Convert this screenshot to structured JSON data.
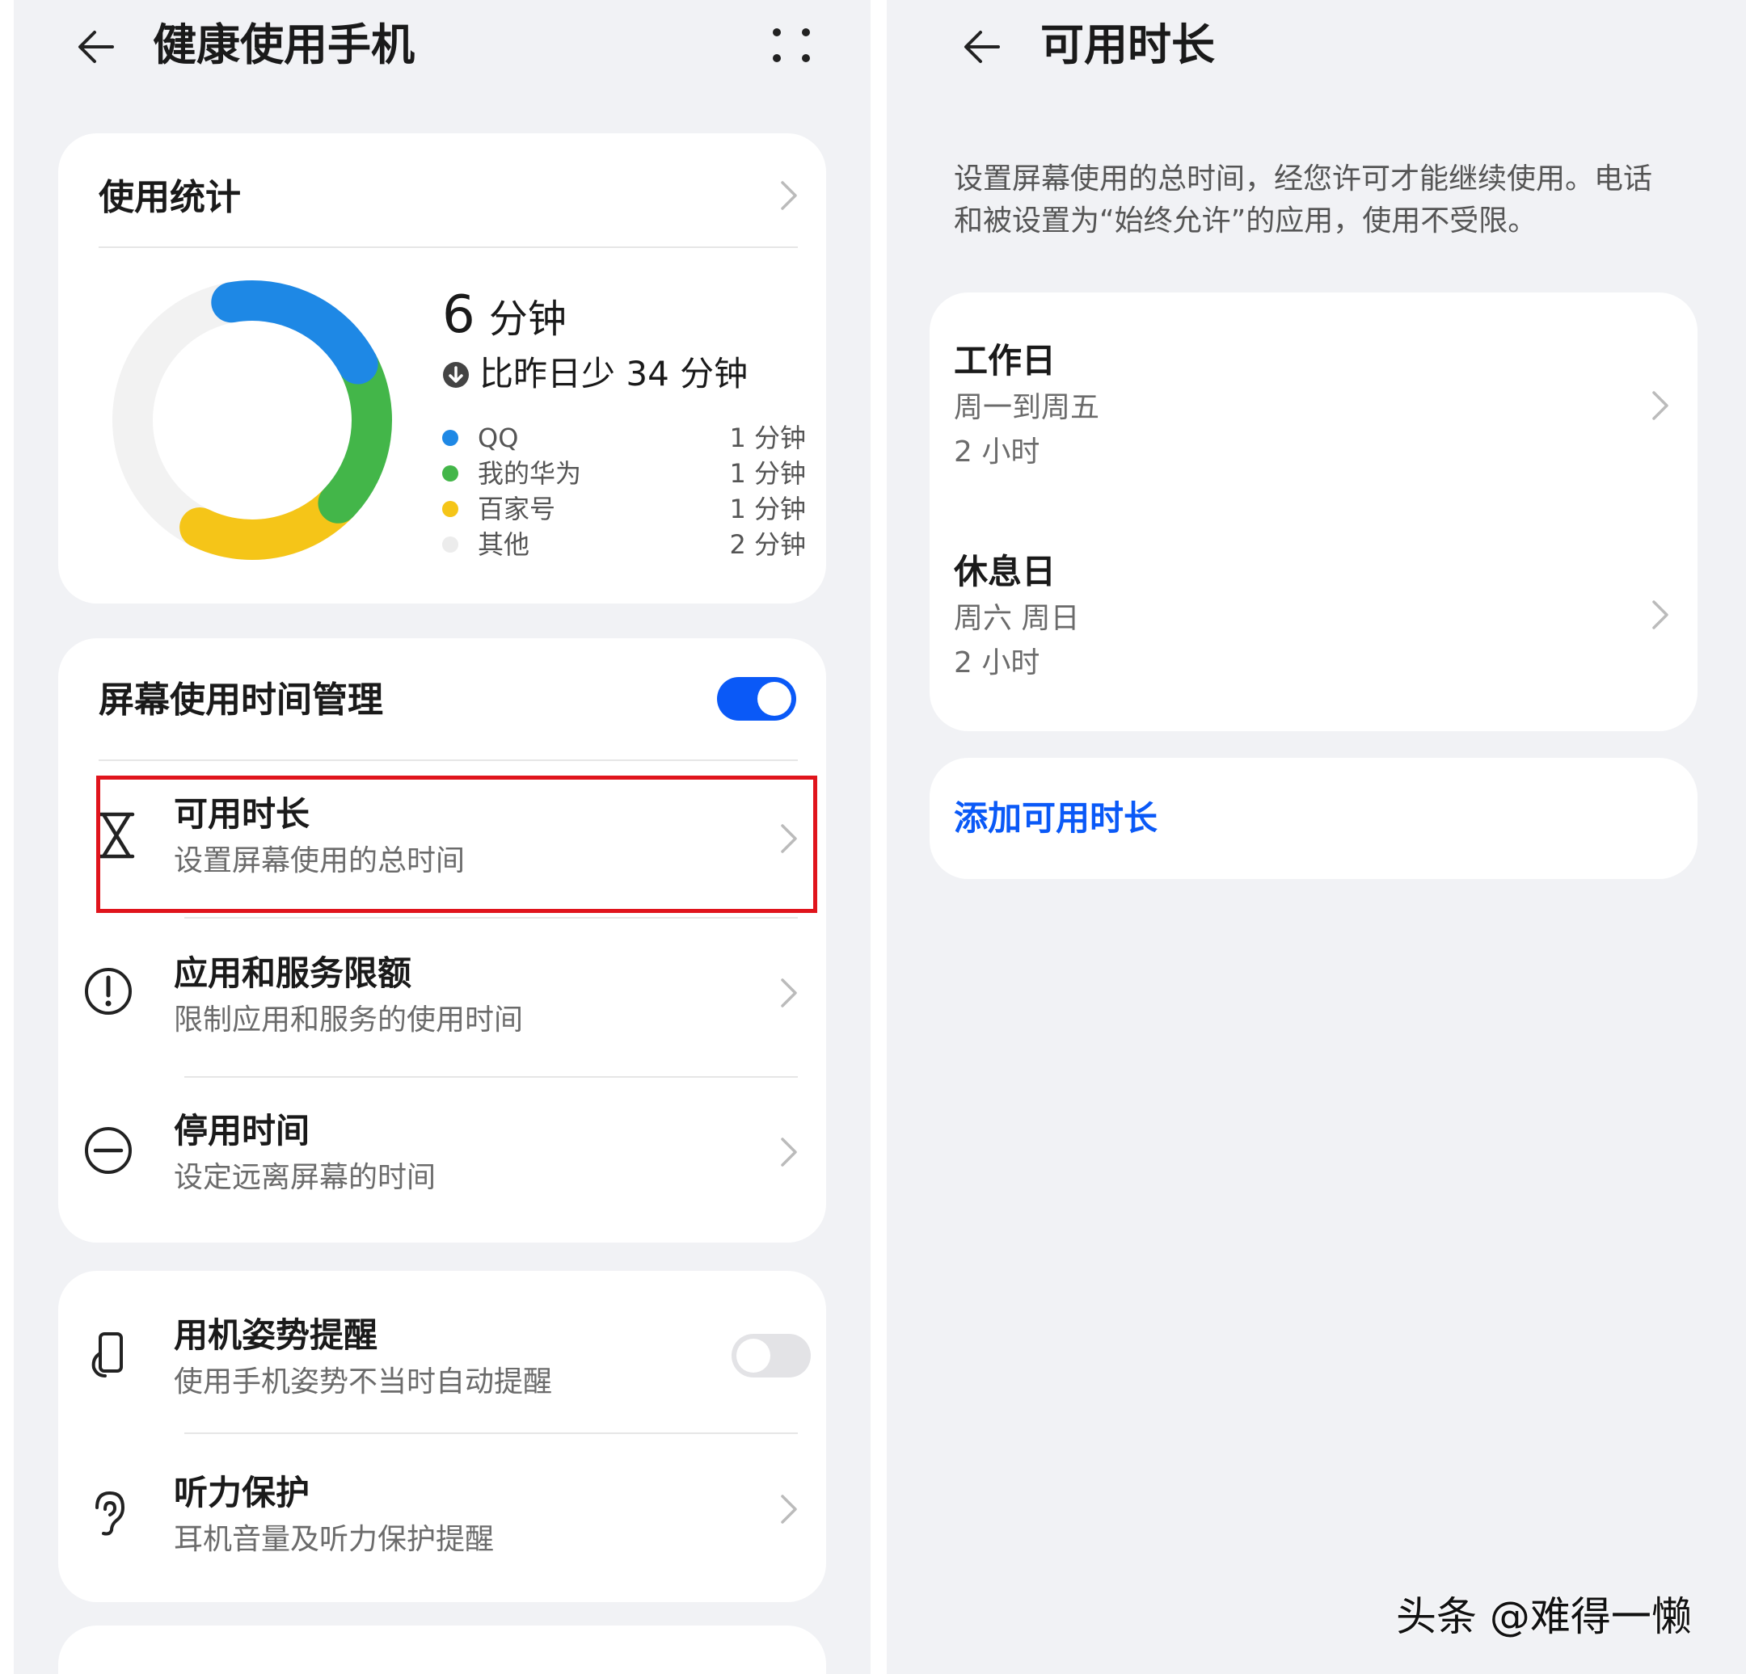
{
  "left_screen": {
    "title": "健康使用手机",
    "usage_stats": {
      "header": "使用统计",
      "total_number": "6",
      "total_unit": "分钟",
      "comparison": "比昨日少 34 分钟",
      "apps": [
        {
          "name": "QQ",
          "time": "1 分钟",
          "color": "#1e88e5",
          "minutes": 1
        },
        {
          "name": "我的华为",
          "time": "1 分钟",
          "color": "#43b649",
          "minutes": 1
        },
        {
          "name": "百家号",
          "time": "1 分钟",
          "color": "#f5c518",
          "minutes": 1
        },
        {
          "name": "其他",
          "time": "2 分钟",
          "color": "#ececec",
          "minutes": 2
        }
      ]
    },
    "screen_time": {
      "header": "屏幕使用时间管理",
      "toggle_on": true,
      "items": [
        {
          "title": "可用时长",
          "subtitle": "设置屏幕使用的总时间",
          "icon": "hourglass-icon"
        },
        {
          "title": "应用和服务限额",
          "subtitle": "限制应用和服务的使用时间",
          "icon": "exclamation-circle-icon"
        },
        {
          "title": "停用时间",
          "subtitle": "设定远离屏幕的时间",
          "icon": "minus-circle-icon"
        }
      ]
    },
    "other": {
      "items": [
        {
          "title": "用机姿势提醒",
          "subtitle": "使用手机姿势不当时自动提醒",
          "icon": "phone-hand-icon",
          "toggle_on": false
        },
        {
          "title": "听力保护",
          "subtitle": "耳机音量及听力保护提醒",
          "icon": "ear-icon"
        }
      ]
    }
  },
  "right_screen": {
    "title": "可用时长",
    "description": "设置屏幕使用的总时间，经您许可才能继续使用。电话和被设置为“始终允许”的应用，使用不受限。",
    "schedules": [
      {
        "title": "工作日",
        "days": "周一到周五",
        "duration": "2 小时"
      },
      {
        "title": "休息日",
        "days": "周六 周日",
        "duration": "2 小时"
      }
    ],
    "add_button": "添加可用时长"
  },
  "watermark": "头条 @难得一懒",
  "colors": {
    "accent": "#0a59f7",
    "highlight": "#e0141c",
    "background": "#f1f2f5"
  }
}
